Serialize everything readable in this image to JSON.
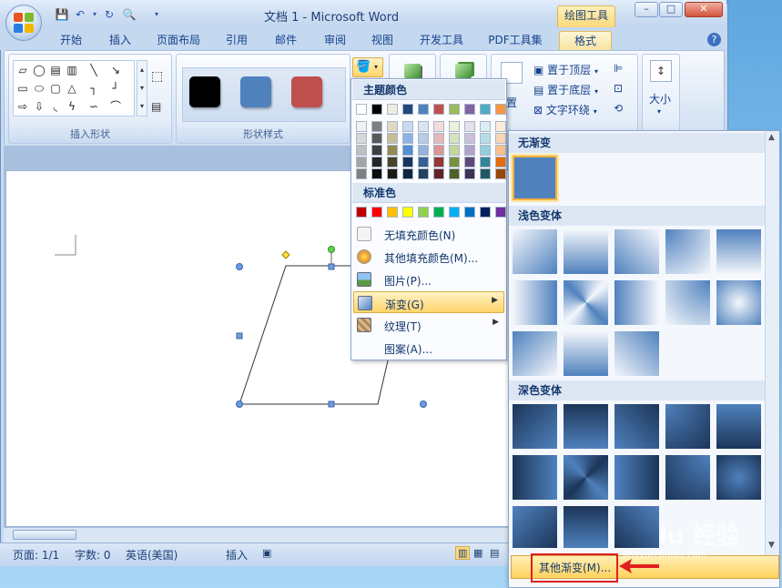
{
  "window": {
    "title": "文档 1 - Microsoft Word",
    "context_tab": "绘图工具",
    "controls": {
      "minimize": "–",
      "maximize": "□",
      "close": "✕"
    }
  },
  "tabs": [
    {
      "label": "开始"
    },
    {
      "label": "插入"
    },
    {
      "label": "页面布局"
    },
    {
      "label": "引用"
    },
    {
      "label": "邮件"
    },
    {
      "label": "审阅"
    },
    {
      "label": "视图"
    },
    {
      "label": "开发工具"
    },
    {
      "label": "PDF工具集"
    },
    {
      "label": "格式"
    }
  ],
  "ribbon": {
    "insert_shapes_label": "插入形状",
    "shape_styles_label": "形状样式",
    "bring_to_front": "置于顶层",
    "send_to_back": "置于底层",
    "text_wrap": "文字环绕",
    "size_label": "大小",
    "position_partial": "置",
    "style_colors": [
      "#000000",
      "#4f81bd",
      "#c0504d"
    ]
  },
  "color_menu": {
    "theme_colors_header": "主题颜色",
    "standard_colors_header": "标准色",
    "theme_colors": [
      "#ffffff",
      "#000000",
      "#eeece1",
      "#1f497d",
      "#4f81bd",
      "#c0504d",
      "#9bbb59",
      "#8064a2",
      "#4bacc6",
      "#f79646"
    ],
    "theme_tints": [
      [
        "#f2f2f2",
        "#7f7f7f",
        "#ddd9c3",
        "#c6d9f0",
        "#dbe5f1",
        "#f2dcdb",
        "#ebf1dd",
        "#e5e0ec",
        "#dbeef3",
        "#fdeada"
      ],
      [
        "#d8d8d8",
        "#595959",
        "#c4bd97",
        "#8db3e2",
        "#b8cce4",
        "#e5b9b7",
        "#d7e3bc",
        "#ccc1d9",
        "#b7dde8",
        "#fbd5b5"
      ],
      [
        "#bfbfbf",
        "#3f3f3f",
        "#938953",
        "#548dd4",
        "#95b3d7",
        "#d99694",
        "#c3d69b",
        "#b2a2c7",
        "#92cddc",
        "#fac08f"
      ],
      [
        "#a5a5a5",
        "#262626",
        "#494429",
        "#17365d",
        "#366092",
        "#953734",
        "#76923c",
        "#5f497a",
        "#31859b",
        "#e36c09"
      ],
      [
        "#7f7f7f",
        "#0c0c0c",
        "#1d1b10",
        "#0f243e",
        "#244061",
        "#632423",
        "#4f6128",
        "#3f3151",
        "#205867",
        "#974806"
      ]
    ],
    "standard_colors": [
      "#c00000",
      "#ff0000",
      "#ffc000",
      "#ffff00",
      "#92d050",
      "#00b050",
      "#00b0f0",
      "#0070c0",
      "#002060",
      "#7030a0"
    ],
    "items": [
      {
        "label": "无填充颜色(N)"
      },
      {
        "label": "其他填充颜色(M)..."
      },
      {
        "label": "图片(P)..."
      },
      {
        "label": "渐变(G)"
      },
      {
        "label": "纹理(T)"
      },
      {
        "label": "图案(A)..."
      }
    ]
  },
  "gradient_gallery": {
    "no_gradient_header": "无渐变",
    "light_header": "浅色变体",
    "dark_header": "深色变体",
    "more_gradients": "其他渐变(M)...",
    "base_color": "#4f81bd"
  },
  "statusbar": {
    "page": "页面: 1/1",
    "words": "字数: 0",
    "language": "英语(美国)",
    "mode": "插入"
  },
  "watermark": {
    "text": "Baidu 经验",
    "sub": "jingyan.baidu.com"
  }
}
